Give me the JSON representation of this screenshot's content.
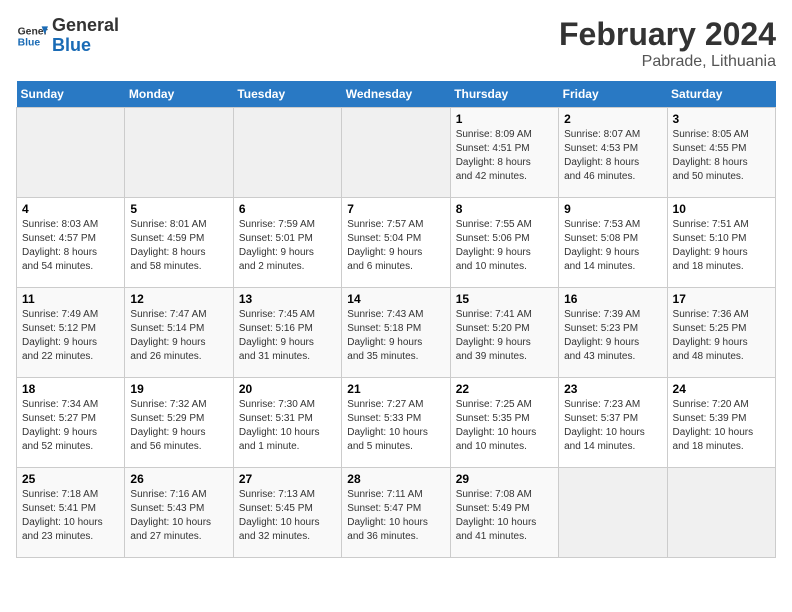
{
  "header": {
    "logo_text_general": "General",
    "logo_text_blue": "Blue",
    "calendar_title": "February 2024",
    "calendar_subtitle": "Pabrade, Lithuania"
  },
  "weekdays": [
    "Sunday",
    "Monday",
    "Tuesday",
    "Wednesday",
    "Thursday",
    "Friday",
    "Saturday"
  ],
  "weeks": [
    [
      {
        "day": "",
        "info": ""
      },
      {
        "day": "",
        "info": ""
      },
      {
        "day": "",
        "info": ""
      },
      {
        "day": "",
        "info": ""
      },
      {
        "day": "1",
        "info": "Sunrise: 8:09 AM\nSunset: 4:51 PM\nDaylight: 8 hours\nand 42 minutes."
      },
      {
        "day": "2",
        "info": "Sunrise: 8:07 AM\nSunset: 4:53 PM\nDaylight: 8 hours\nand 46 minutes."
      },
      {
        "day": "3",
        "info": "Sunrise: 8:05 AM\nSunset: 4:55 PM\nDaylight: 8 hours\nand 50 minutes."
      }
    ],
    [
      {
        "day": "4",
        "info": "Sunrise: 8:03 AM\nSunset: 4:57 PM\nDaylight: 8 hours\nand 54 minutes."
      },
      {
        "day": "5",
        "info": "Sunrise: 8:01 AM\nSunset: 4:59 PM\nDaylight: 8 hours\nand 58 minutes."
      },
      {
        "day": "6",
        "info": "Sunrise: 7:59 AM\nSunset: 5:01 PM\nDaylight: 9 hours\nand 2 minutes."
      },
      {
        "day": "7",
        "info": "Sunrise: 7:57 AM\nSunset: 5:04 PM\nDaylight: 9 hours\nand 6 minutes."
      },
      {
        "day": "8",
        "info": "Sunrise: 7:55 AM\nSunset: 5:06 PM\nDaylight: 9 hours\nand 10 minutes."
      },
      {
        "day": "9",
        "info": "Sunrise: 7:53 AM\nSunset: 5:08 PM\nDaylight: 9 hours\nand 14 minutes."
      },
      {
        "day": "10",
        "info": "Sunrise: 7:51 AM\nSunset: 5:10 PM\nDaylight: 9 hours\nand 18 minutes."
      }
    ],
    [
      {
        "day": "11",
        "info": "Sunrise: 7:49 AM\nSunset: 5:12 PM\nDaylight: 9 hours\nand 22 minutes."
      },
      {
        "day": "12",
        "info": "Sunrise: 7:47 AM\nSunset: 5:14 PM\nDaylight: 9 hours\nand 26 minutes."
      },
      {
        "day": "13",
        "info": "Sunrise: 7:45 AM\nSunset: 5:16 PM\nDaylight: 9 hours\nand 31 minutes."
      },
      {
        "day": "14",
        "info": "Sunrise: 7:43 AM\nSunset: 5:18 PM\nDaylight: 9 hours\nand 35 minutes."
      },
      {
        "day": "15",
        "info": "Sunrise: 7:41 AM\nSunset: 5:20 PM\nDaylight: 9 hours\nand 39 minutes."
      },
      {
        "day": "16",
        "info": "Sunrise: 7:39 AM\nSunset: 5:23 PM\nDaylight: 9 hours\nand 43 minutes."
      },
      {
        "day": "17",
        "info": "Sunrise: 7:36 AM\nSunset: 5:25 PM\nDaylight: 9 hours\nand 48 minutes."
      }
    ],
    [
      {
        "day": "18",
        "info": "Sunrise: 7:34 AM\nSunset: 5:27 PM\nDaylight: 9 hours\nand 52 minutes."
      },
      {
        "day": "19",
        "info": "Sunrise: 7:32 AM\nSunset: 5:29 PM\nDaylight: 9 hours\nand 56 minutes."
      },
      {
        "day": "20",
        "info": "Sunrise: 7:30 AM\nSunset: 5:31 PM\nDaylight: 10 hours\nand 1 minute."
      },
      {
        "day": "21",
        "info": "Sunrise: 7:27 AM\nSunset: 5:33 PM\nDaylight: 10 hours\nand 5 minutes."
      },
      {
        "day": "22",
        "info": "Sunrise: 7:25 AM\nSunset: 5:35 PM\nDaylight: 10 hours\nand 10 minutes."
      },
      {
        "day": "23",
        "info": "Sunrise: 7:23 AM\nSunset: 5:37 PM\nDaylight: 10 hours\nand 14 minutes."
      },
      {
        "day": "24",
        "info": "Sunrise: 7:20 AM\nSunset: 5:39 PM\nDaylight: 10 hours\nand 18 minutes."
      }
    ],
    [
      {
        "day": "25",
        "info": "Sunrise: 7:18 AM\nSunset: 5:41 PM\nDaylight: 10 hours\nand 23 minutes."
      },
      {
        "day": "26",
        "info": "Sunrise: 7:16 AM\nSunset: 5:43 PM\nDaylight: 10 hours\nand 27 minutes."
      },
      {
        "day": "27",
        "info": "Sunrise: 7:13 AM\nSunset: 5:45 PM\nDaylight: 10 hours\nand 32 minutes."
      },
      {
        "day": "28",
        "info": "Sunrise: 7:11 AM\nSunset: 5:47 PM\nDaylight: 10 hours\nand 36 minutes."
      },
      {
        "day": "29",
        "info": "Sunrise: 7:08 AM\nSunset: 5:49 PM\nDaylight: 10 hours\nand 41 minutes."
      },
      {
        "day": "",
        "info": ""
      },
      {
        "day": "",
        "info": ""
      }
    ]
  ]
}
